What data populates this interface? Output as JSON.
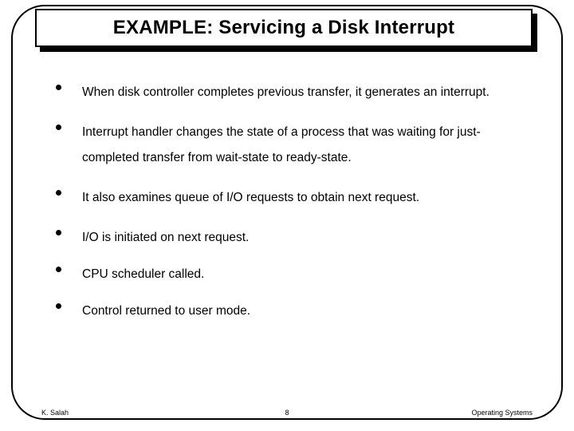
{
  "title": "EXAMPLE: Servicing a Disk Interrupt",
  "bullets": [
    "When disk controller completes previous transfer, it generates an interrupt.",
    "Interrupt handler changes the state of a process that was waiting for just-completed transfer from wait-state to ready-state.",
    "It also examines queue of I/O requests to obtain next request.",
    "I/O is initiated on next request.",
    "CPU scheduler called.",
    "Control returned to user mode."
  ],
  "footer": {
    "left": "K. Salah",
    "center": "8",
    "right": "Operating Systems"
  }
}
